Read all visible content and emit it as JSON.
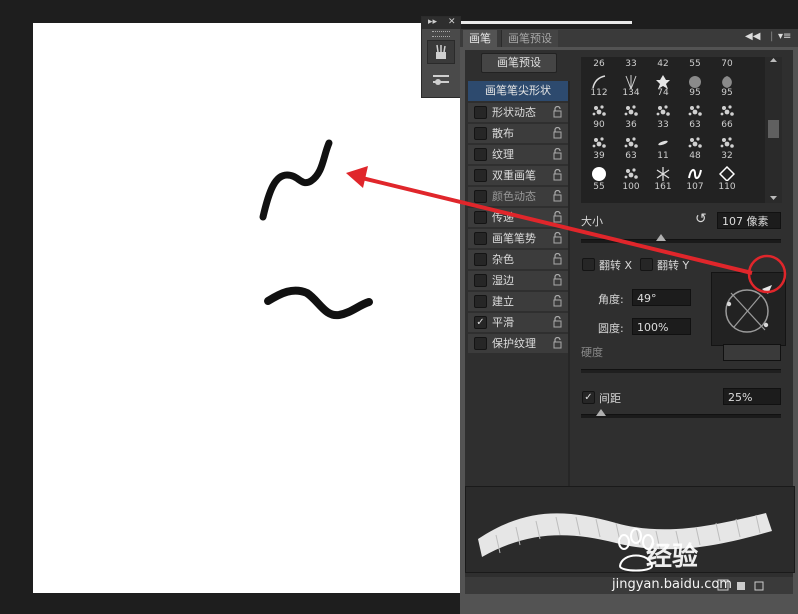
{
  "panel": {
    "tabs": [
      {
        "label": "画笔"
      },
      {
        "label": "画笔预设"
      }
    ],
    "collapse_glyph": "◀◀",
    "menu_glyph": "▾≡",
    "preset_button": "画笔预设",
    "section_header": "画笔笔尖形状",
    "options": [
      {
        "label": "形状动态",
        "checked": false
      },
      {
        "label": "散布",
        "checked": false
      },
      {
        "label": "纹理",
        "checked": false
      },
      {
        "label": "双重画笔",
        "checked": false
      },
      {
        "label": "颜色动态",
        "checked": false
      },
      {
        "label": "传递",
        "checked": false
      },
      {
        "label": "画笔笔势",
        "checked": false
      },
      {
        "label": "杂色",
        "checked": false
      },
      {
        "label": "湿边",
        "checked": false
      },
      {
        "label": "建立",
        "checked": false
      },
      {
        "label": "平滑",
        "checked": true,
        "mark": "✓"
      },
      {
        "label": "保护纹理",
        "checked": false
      }
    ],
    "brush_tips": {
      "rows": [
        [
          "26",
          "33",
          "42",
          "55",
          "70"
        ],
        [
          "112",
          "134",
          "74",
          "95",
          "95"
        ],
        [
          "90",
          "36",
          "33",
          "63",
          "66"
        ],
        [
          "39",
          "63",
          "11",
          "48",
          "32"
        ],
        [
          "55",
          "100",
          "161",
          "107",
          "110"
        ]
      ]
    },
    "size": {
      "label": "大小",
      "value": "107 像素",
      "reset_glyph": "↺",
      "slider_fraction": 0.4
    },
    "flip_x": {
      "label": "翻转 X"
    },
    "flip_y": {
      "label": "翻转 Y"
    },
    "angle": {
      "label": "角度:",
      "value": "49°"
    },
    "roundness": {
      "label": "圆度:",
      "value": "100%"
    },
    "hardness": {
      "label": "硬度"
    },
    "spacing": {
      "label": "间距",
      "value": "25%",
      "checked": true,
      "mark": "✓",
      "slider_fraction": 0.1
    }
  },
  "mini_panel": {
    "expand_glyph": "▸▸",
    "close_glyph": "✕"
  },
  "watermark": {
    "brand": "经验",
    "url": "jingyan.baidu.com"
  },
  "colors": {
    "annotation_red": "#e0262b",
    "panel_bg": "#535353",
    "accent_blue": "#2d4a6e"
  }
}
